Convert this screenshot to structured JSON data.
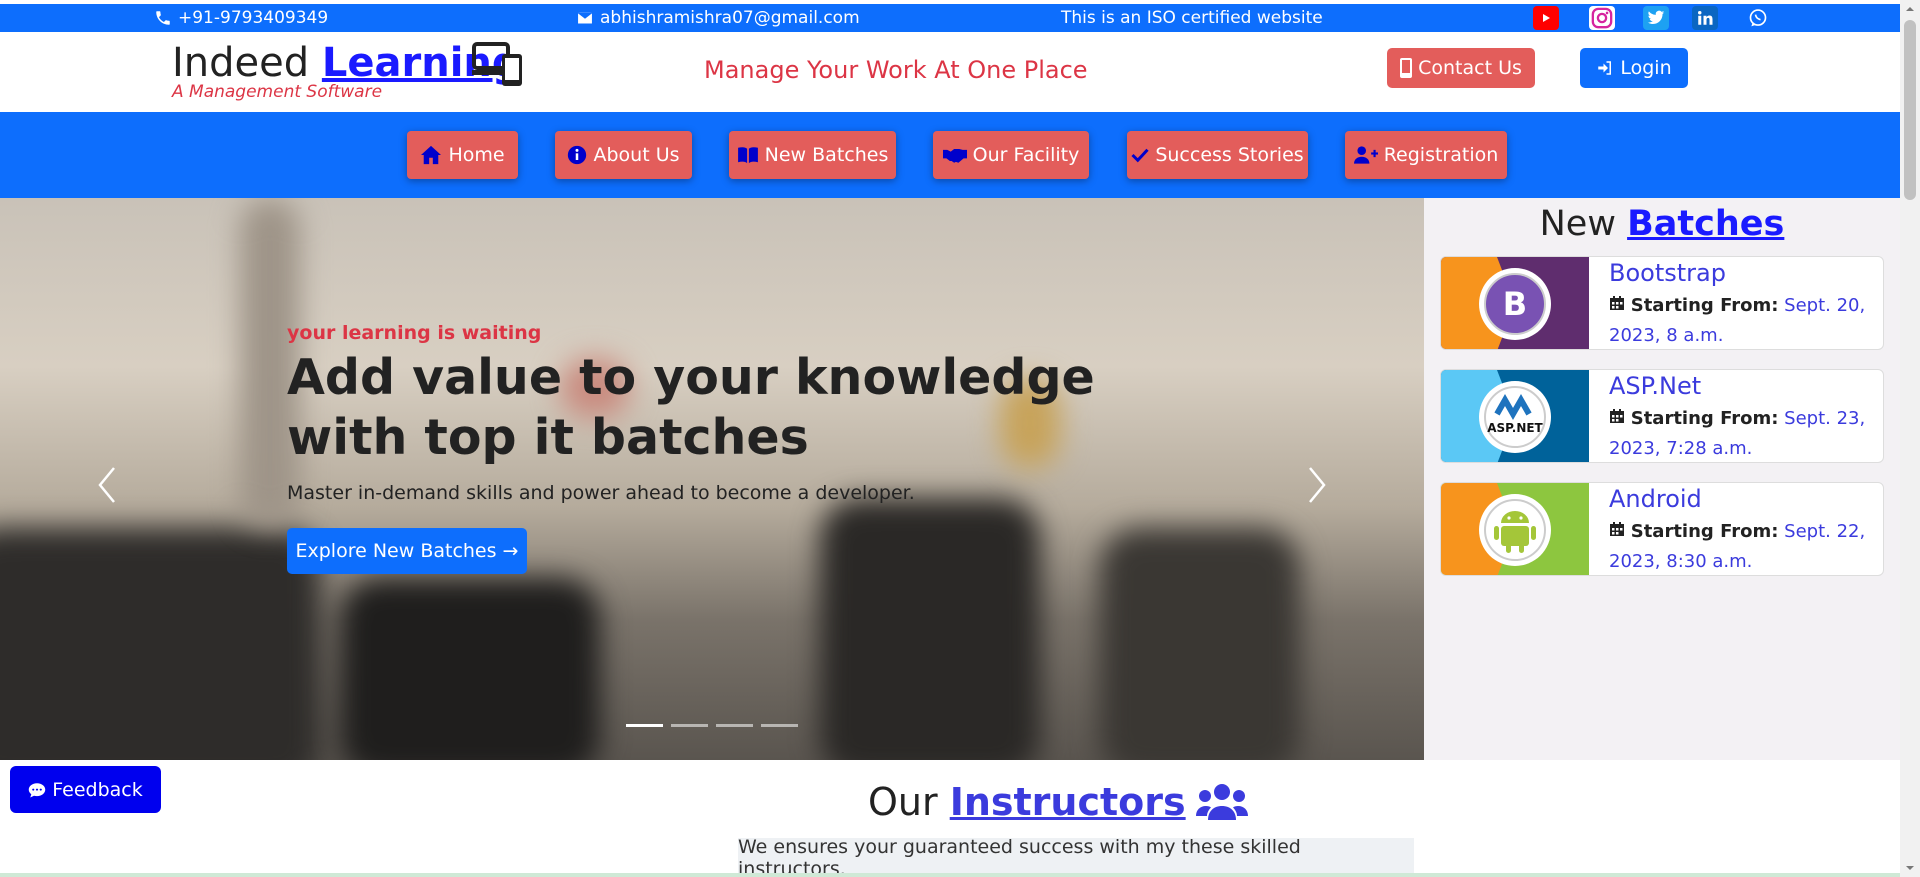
{
  "topbar": {
    "phone": "+91-9793409349",
    "email": "abhishramishra07@gmail.com",
    "iso_text": "This is an ISO certified website",
    "social": [
      "youtube-icon",
      "instagram-icon",
      "twitter-icon",
      "linkedin-icon",
      "whatsapp-icon"
    ]
  },
  "header": {
    "brand_part1": "Indeed ",
    "brand_part2": "Learning",
    "brand_sub": "A Management Software",
    "tagline": "Manage Your Work At One Place",
    "contact_label": "Contact Us",
    "login_label": "Login"
  },
  "nav": {
    "items": [
      {
        "label": "Home",
        "icon": "home-icon"
      },
      {
        "label": "About Us",
        "icon": "info-icon"
      },
      {
        "label": "New Batches",
        "icon": "book-icon"
      },
      {
        "label": "Our Facility",
        "icon": "handshake-icon"
      },
      {
        "label": "Success Stories",
        "icon": "check-icon"
      },
      {
        "label": "Registration",
        "icon": "user-plus-icon"
      }
    ]
  },
  "hero": {
    "kicker": "your learning is waiting",
    "title": "Add value to your knowledge with top it batches",
    "description": "Master in-demand skills and power ahead to become a developer.",
    "cta": "Explore New Batches →",
    "slides": 4,
    "active_slide": 1
  },
  "sidebar": {
    "title_part1": "New ",
    "title_part2": "Batches",
    "start_label": "Starting From:",
    "batches": [
      {
        "name": "Bootstrap",
        "date": "Sept. 20, 2023, 8 a.m.",
        "logo": "bootstrap-logo"
      },
      {
        "name": "ASP.Net",
        "date": "Sept. 23, 2023, 7:28 a.m.",
        "logo": "aspnet-logo"
      },
      {
        "name": "Android",
        "date": "Sept. 22, 2023, 8:30 a.m.",
        "logo": "android-logo"
      }
    ]
  },
  "instructors": {
    "title_part1": "Our ",
    "title_part2": "Instructors ",
    "subtitle": "We ensures your guaranteed success with my these skilled instructors."
  },
  "feedback": {
    "label": "Feedback"
  },
  "colors": {
    "primary": "#0d6efd",
    "danger": "#dc3545",
    "nav_button": "#e35d5b",
    "link": "#1a1aff"
  }
}
